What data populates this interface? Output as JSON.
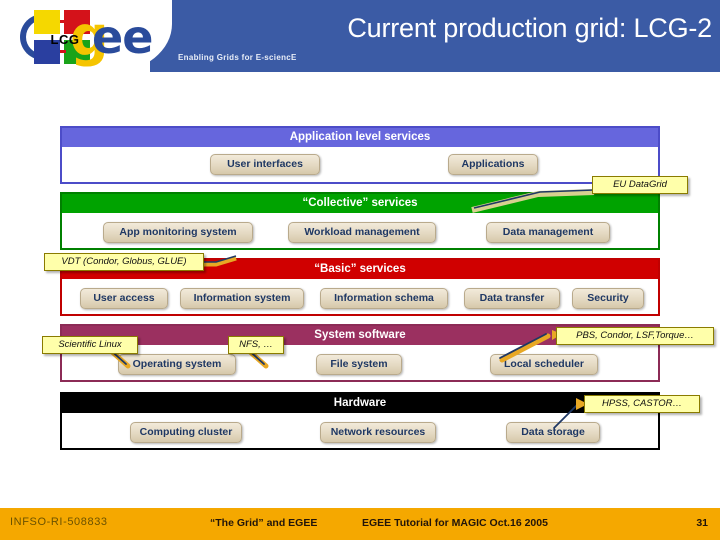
{
  "header": {
    "title": "Current production grid: LCG-2",
    "subtitle": "Enabling Grids for E-sciencE",
    "logo": {
      "lcg_label": "LCG",
      "ghost_g": "g",
      "ee_text": "ee"
    }
  },
  "diagram": {
    "layers": [
      {
        "id": "application",
        "title": "Application level services",
        "header_color": "#6666DD",
        "border_color": "#4C4CC8",
        "items": [
          {
            "label": "User interfaces"
          },
          {
            "label": "Applications"
          }
        ]
      },
      {
        "id": "collective",
        "title": "“Collective” services",
        "header_color": "#00A300",
        "border_color": "#008000",
        "items": [
          {
            "label": "App monitoring system"
          },
          {
            "label": "Workload management"
          },
          {
            "label": "Data management"
          }
        ]
      },
      {
        "id": "basic",
        "title": "“Basic” services",
        "header_color": "#D00000",
        "border_color": "#C00000",
        "items": [
          {
            "label": "User access"
          },
          {
            "label": "Information system"
          },
          {
            "label": "Information schema"
          },
          {
            "label": "Data transfer"
          },
          {
            "label": "Security"
          }
        ]
      },
      {
        "id": "system-software",
        "title": "System software",
        "header_color": "#9B3060",
        "border_color": "#8C2B56",
        "items": [
          {
            "label": "Operating system"
          },
          {
            "label": "File system"
          },
          {
            "label": "Local scheduler"
          }
        ]
      },
      {
        "id": "hardware",
        "title": "Hardware",
        "header_color": "#000000",
        "border_color": "#000000",
        "items": [
          {
            "label": "Computing cluster"
          },
          {
            "label": "Network resources"
          },
          {
            "label": "Data storage"
          }
        ]
      }
    ],
    "callouts": [
      {
        "id": "eu-datagrid",
        "label": "EU DataGrid"
      },
      {
        "id": "vdt",
        "label": "VDT (Condor, Globus, GLUE)"
      },
      {
        "id": "scientific-linux",
        "label": "Scientific Linux"
      },
      {
        "id": "nfs",
        "label": "NFS, …"
      },
      {
        "id": "batch-systems",
        "label": "PBS, Condor, LSF,Torque…"
      },
      {
        "id": "mass-storage",
        "label": "HPSS, CASTOR…"
      }
    ]
  },
  "footer": {
    "project_id": "INFSO-RI-508833",
    "talk_title": "“The Grid” and EGEE",
    "event": "EGEE Tutorial  for MAGIC  Oct.16 2005",
    "page_number": "31"
  }
}
